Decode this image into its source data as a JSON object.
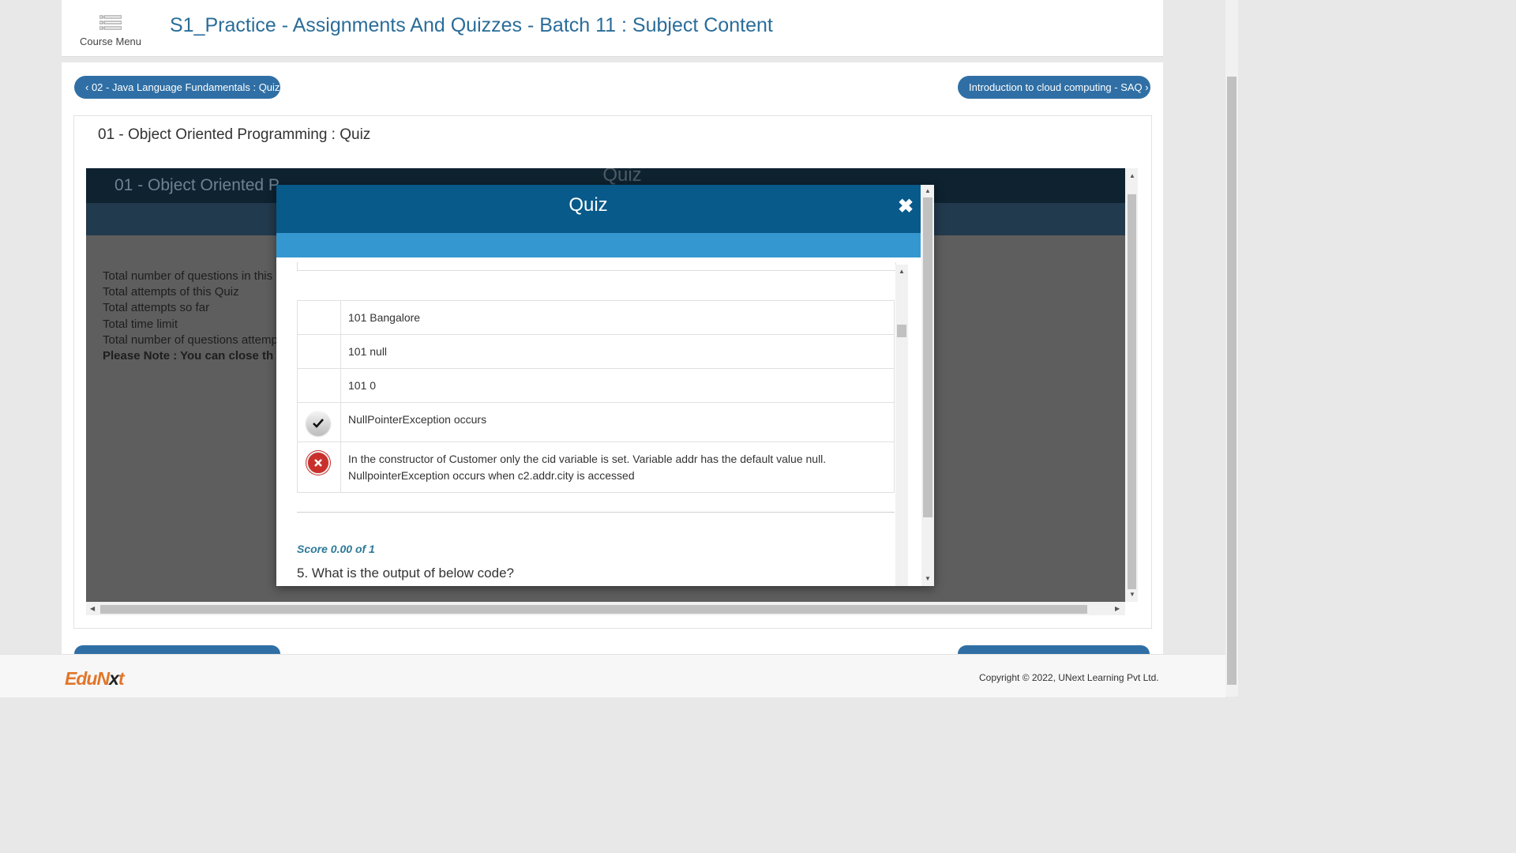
{
  "header": {
    "course_menu_label": "Course Menu",
    "menu_icon": "list-icon",
    "title": "S1_Practice - Assignments And Quizzes - Batch 11 : Subject Content"
  },
  "nav": {
    "prev_label": "‹ 02 - Java Language Fundamentals : Quiz",
    "next_label": "Introduction to cloud computing - SAQ ›"
  },
  "content": {
    "title": "01 - Object Oriented Programming : Quiz",
    "frame": {
      "header_title": "Quiz",
      "subheader_title": "01 - Object Oriented P",
      "info_lines": [
        "Total number of questions in this",
        "Total attempts of this Quiz",
        "Total attempts so far",
        "Total time limit",
        "Total number of questions attemp"
      ],
      "note": "Please Note : You can close th"
    }
  },
  "modal": {
    "title": "Quiz",
    "close_icon": "close-icon",
    "options": [
      {
        "text": "101 Bangalore",
        "mark": ""
      },
      {
        "text": "101 null",
        "mark": ""
      },
      {
        "text": "101 0",
        "mark": ""
      },
      {
        "text": "NullPointerException occurs",
        "mark": "correct-check-icon"
      },
      {
        "text": "In the constructor of Customer only the cid variable is set. Variable addr has the default value null. NullpointerException occurs when c2.addr.city is accessed",
        "mark": "incorrect-x-icon"
      }
    ],
    "score": "Score 0.00 of 1",
    "next_question": "5. What is the output of below code?"
  },
  "footer": {
    "logo_a": "EduN",
    "logo_b": "x",
    "logo_c": "t",
    "copyright": "Copyright © 2022, UNext Learning Pvt Ltd."
  },
  "colors": {
    "accent": "#2f6fa5",
    "modal_header": "#075a8a",
    "modal_band": "#3597cf",
    "score": "#2d7a9a",
    "logo": "#e1762a"
  }
}
